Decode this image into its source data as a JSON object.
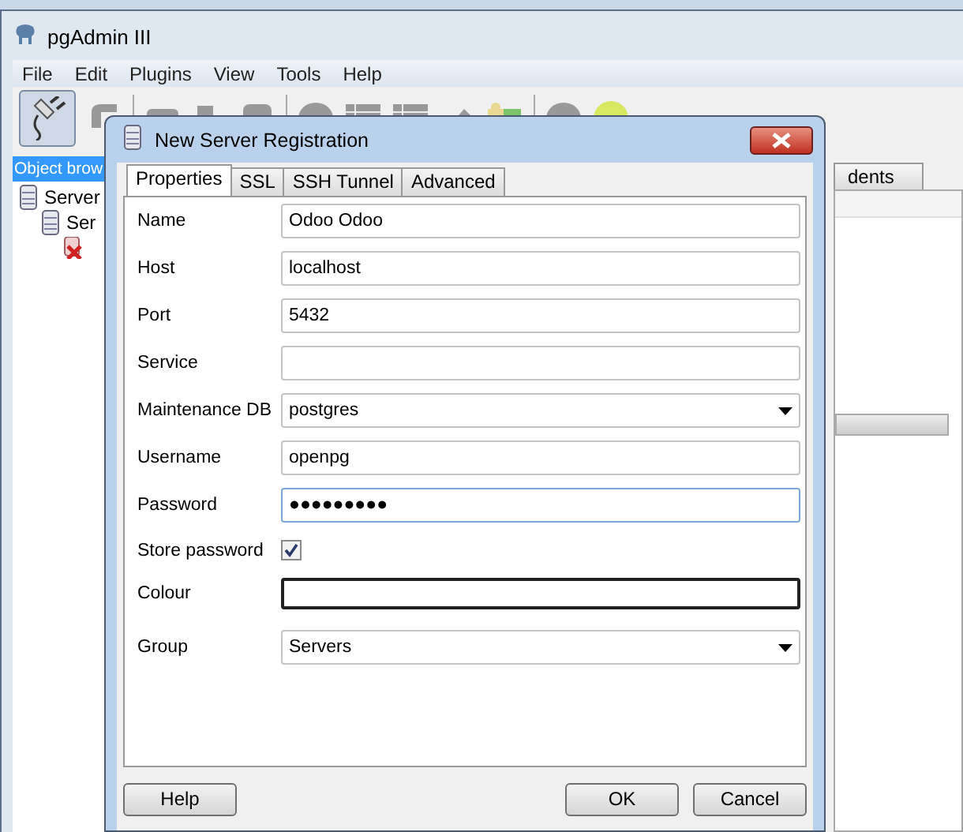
{
  "window": {
    "title": "pgAdmin III"
  },
  "menu": [
    "File",
    "Edit",
    "Plugins",
    "View",
    "Tools",
    "Help"
  ],
  "object_browser": {
    "title": "Object brow",
    "tree": [
      {
        "label": "Server",
        "children": [
          {
            "label": "Ser",
            "children": [
              {
                "kind": "error"
              }
            ]
          }
        ]
      }
    ]
  },
  "background_tab": {
    "label": "dents"
  },
  "dialog": {
    "title": "New Server Registration",
    "tabs": [
      {
        "label": "Properties",
        "selected": true
      },
      {
        "label": "SSL",
        "selected": false
      },
      {
        "label": "SSH Tunnel",
        "selected": false
      },
      {
        "label": "Advanced",
        "selected": false
      }
    ],
    "fields": [
      {
        "label": "Name",
        "kind": "text",
        "value": "Odoo Odoo"
      },
      {
        "label": "Host",
        "kind": "text",
        "value": "localhost"
      },
      {
        "label": "Port",
        "kind": "text",
        "value": "5432"
      },
      {
        "label": "Service",
        "kind": "text"
      },
      {
        "label": "Maintenance DB",
        "kind": "select",
        "value": "postgres"
      },
      {
        "label": "Username",
        "kind": "text",
        "value": "openpg"
      },
      {
        "label": "Password",
        "kind": "password",
        "value": "●●●●●●●●●",
        "focused": true
      },
      {
        "label": "Store password",
        "kind": "checkbox",
        "checked": true
      },
      {
        "label": "Colour",
        "kind": "colour"
      },
      {
        "label": "Group",
        "kind": "select",
        "value": "Servers"
      }
    ],
    "buttons": [
      {
        "label": "Help",
        "kind": "left"
      },
      {
        "label": "OK",
        "kind": "right"
      },
      {
        "label": "Cancel",
        "kind": "right"
      }
    ]
  }
}
